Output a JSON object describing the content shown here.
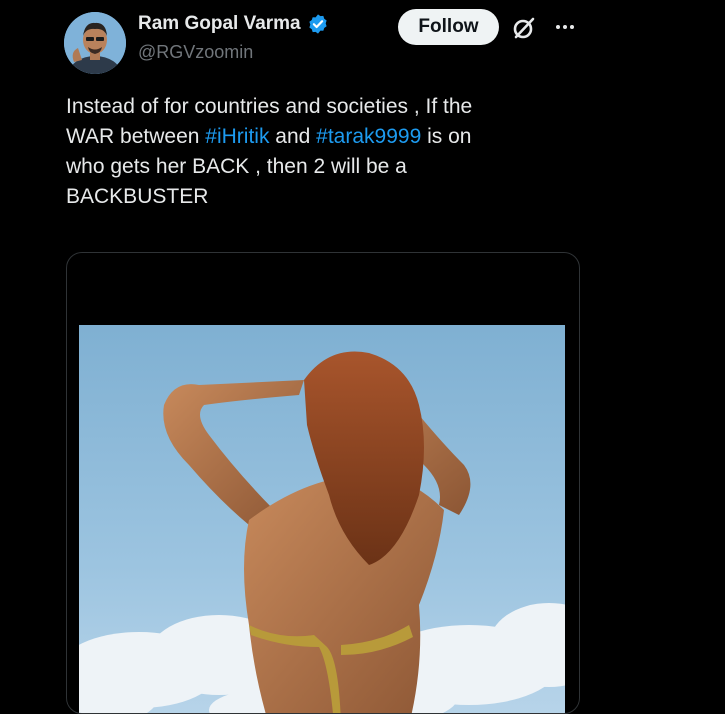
{
  "user": {
    "display_name": "Ram Gopal Varma",
    "handle": "@RGVzoomin",
    "avatar_icon": "profile-photo",
    "verified_icon": "verified-badge-icon",
    "verified_color": "#1d9bf0"
  },
  "actions": {
    "follow_label": "Follow",
    "grok_icon": "grok-icon",
    "more_icon": "more-options-icon"
  },
  "tweet": {
    "line1": "Instead of for countries and societies , If the",
    "line2_a": "WAR between ",
    "line2_tag1": "#iHritik",
    "line2_b": " and ",
    "line2_tag2": "#tarak9999",
    "line2_c": " is on",
    "line3": "who gets her BACK  , then 2 will be a",
    "line4": "BACKBUSTER",
    "hashtag_color": "#1d9bf0"
  },
  "media": {
    "type": "photo"
  },
  "colors": {
    "background": "#000000",
    "text": "#e7e9ea",
    "secondary_text": "#71767b",
    "follow_button_bg": "#eff3f4"
  }
}
